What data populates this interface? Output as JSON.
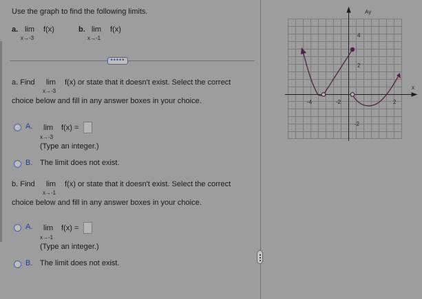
{
  "intro": "Use the graph to find the following limits.",
  "part_a_label": "a.",
  "part_a_lim": "lim",
  "part_a_fn": "f(x)",
  "part_a_sub": "x→-3",
  "part_b_label": "b.",
  "part_b_lim": "lim",
  "part_b_fn": "f(x)",
  "part_b_sub": "x→-1",
  "expand_button": "•••••",
  "qa": {
    "prefix": "a. Find",
    "lim": "lim",
    "suffix": "f(x) or state that it doesn't exist. Select the correct",
    "sub": "x→-3",
    "line2": "choice below and fill in any answer boxes in your choice.",
    "optA_letter": "A.",
    "optA_lim": "lim",
    "optA_fn": "f(x) =",
    "optA_sub": "x→-3",
    "optA_hint": "(Type an integer.)",
    "optB_letter": "B.",
    "optB_text": "The limit does not exist."
  },
  "qb": {
    "prefix": "b. Find",
    "lim": "lim",
    "suffix": "f(x) or state that it doesn't exist. Select the correct",
    "sub": "x→-1",
    "line2": "choice below and fill in any answer boxes in your choice.",
    "optA_letter": "A.",
    "optA_lim": "lim",
    "optA_fn": "f(x) =",
    "optA_sub": "x→-1",
    "optA_hint": "(Type an integer.)",
    "optB_letter": "B.",
    "optB_text": "The limit does not exist."
  },
  "graph": {
    "y_axis_label": "Ay",
    "x_axis_label": "x",
    "x_ticks": [
      "-4",
      "-2",
      "2"
    ],
    "y_ticks": [
      "4",
      "2",
      "-2"
    ],
    "curve_color": "#4a2545"
  }
}
